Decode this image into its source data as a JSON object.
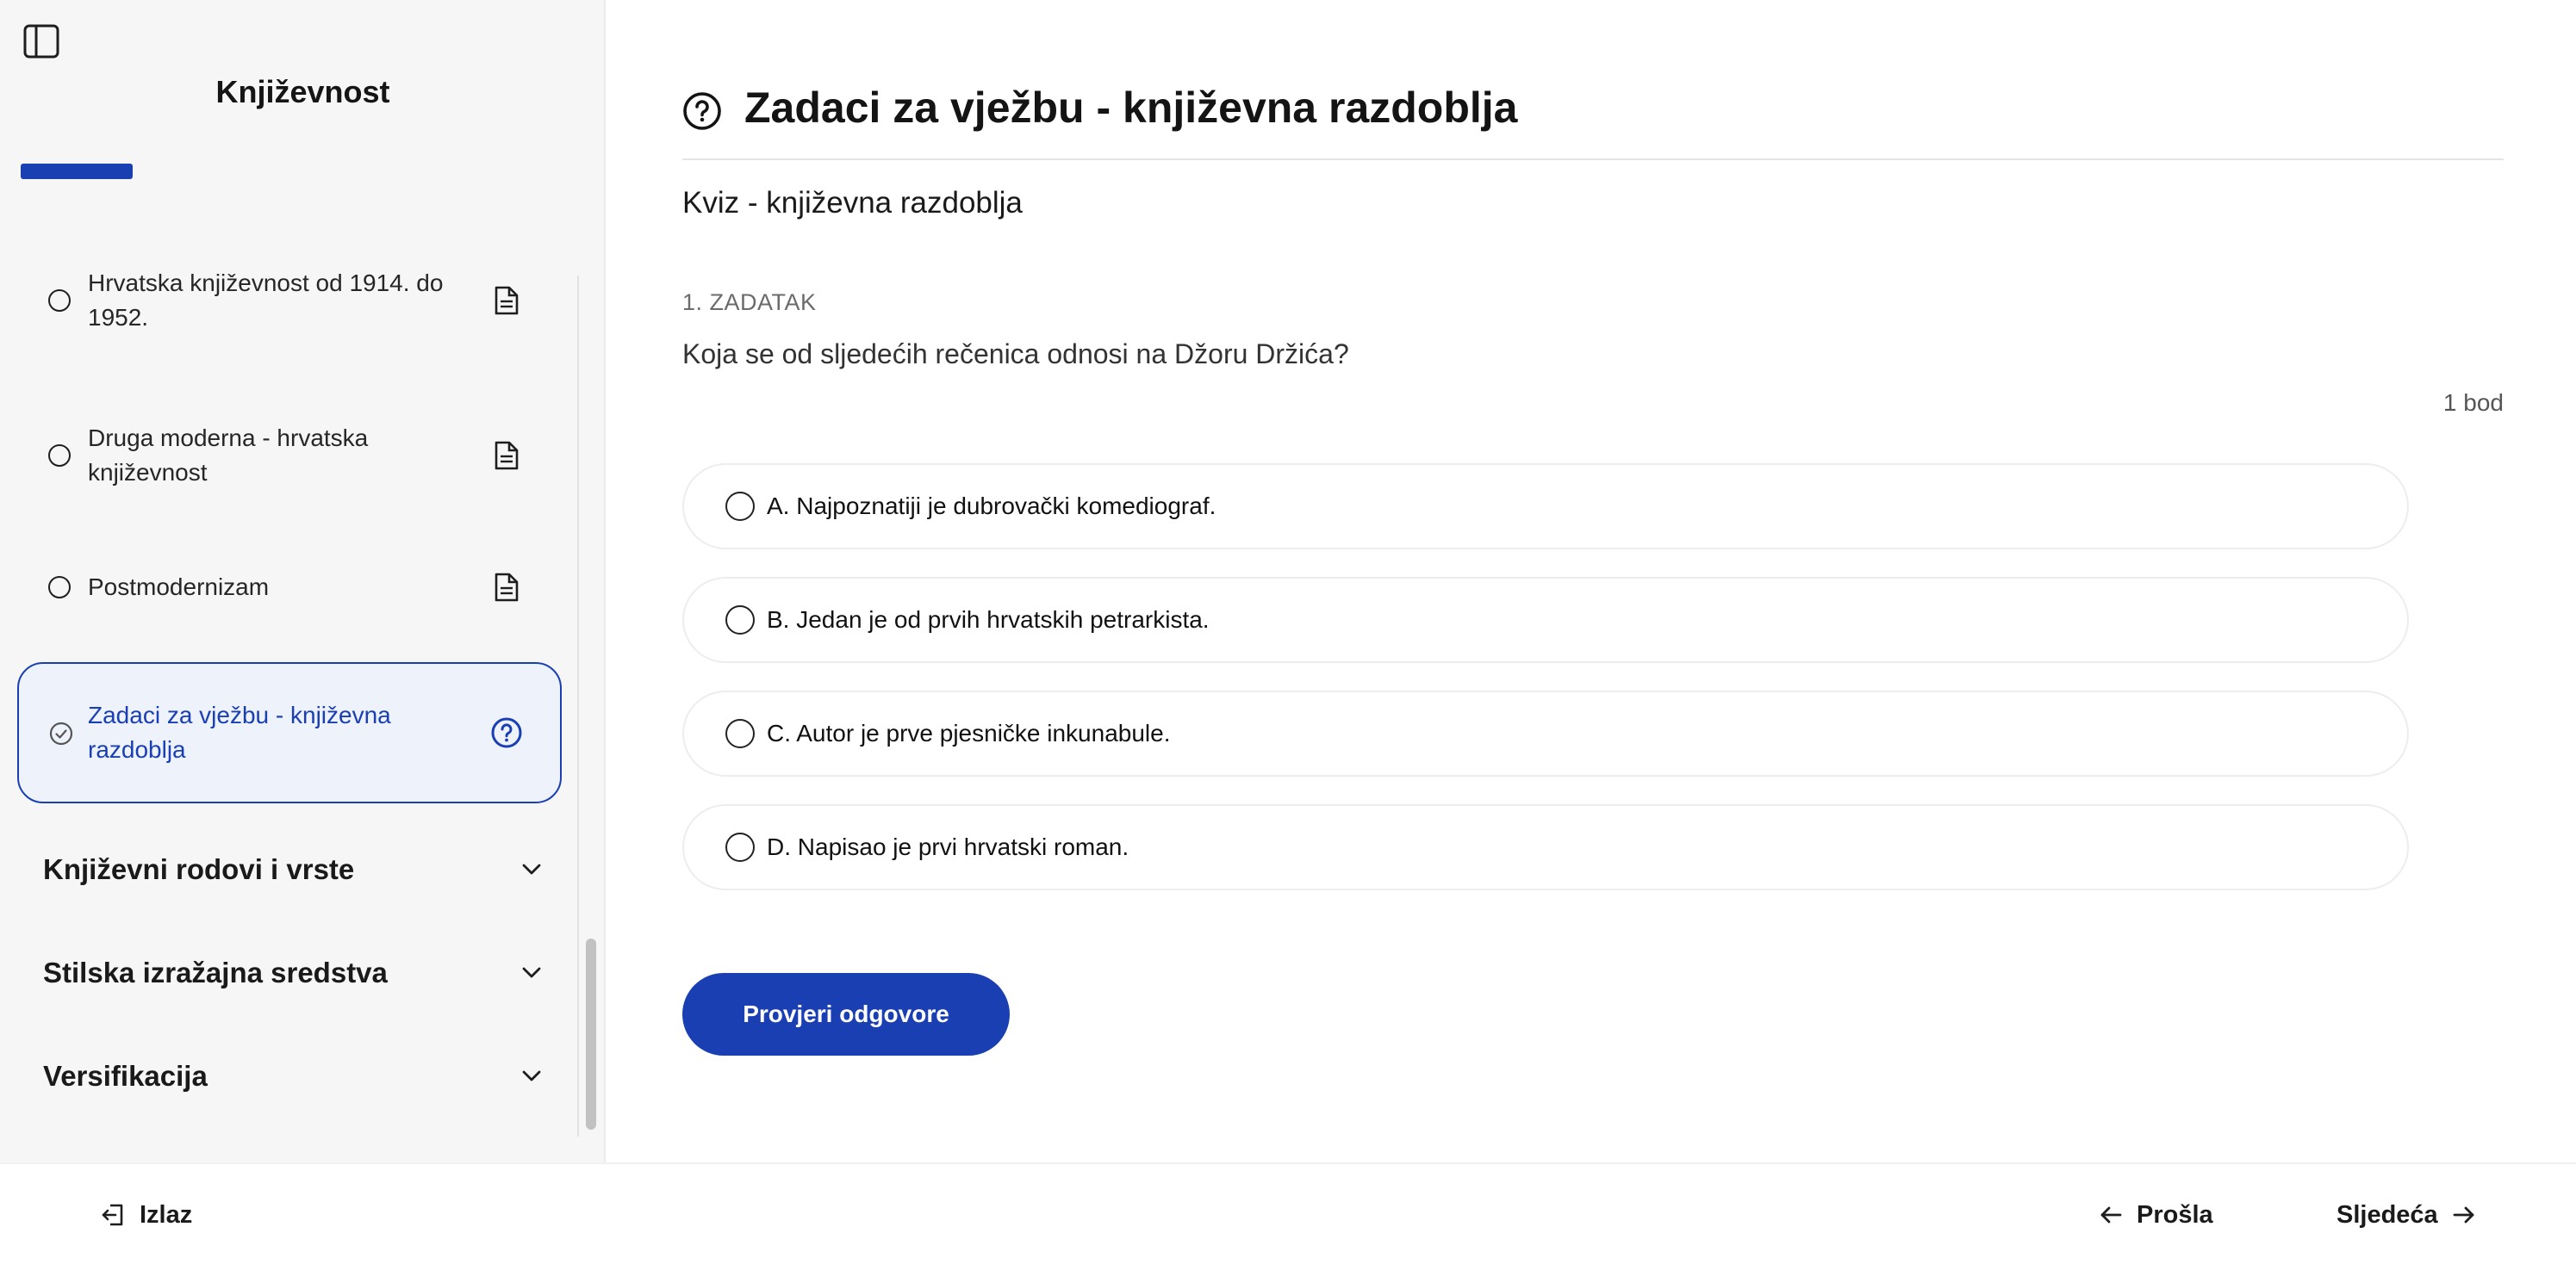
{
  "sidebar": {
    "toggle_icon": "sidebar-panel-icon",
    "course_title": "Književnost",
    "progress_fraction": 0.2,
    "lessons": [
      {
        "label": "Hrvatska književnost od 1914. do 1952.",
        "icon": "document-icon",
        "status": "incomplete"
      },
      {
        "label": "Druga moderna - hrvatska književnost",
        "icon": "document-icon",
        "status": "incomplete"
      },
      {
        "label": "Postmodernizam",
        "icon": "document-icon",
        "status": "incomplete"
      },
      {
        "label": "Zadaci za vježbu - književna razdoblja",
        "icon": "question-circle-icon",
        "status": "active"
      }
    ],
    "sections": [
      {
        "label": "Književni rodovi i vrste",
        "icon": "chevron-down-icon"
      },
      {
        "label": "Stilska izražajna sredstva",
        "icon": "chevron-down-icon"
      },
      {
        "label": "Versifikacija",
        "icon": "chevron-down-icon"
      }
    ]
  },
  "main": {
    "title_icon": "question-circle-icon",
    "title": "Zadaci za vježbu - književna razdoblja",
    "quiz_name": "Kviz - književna razdoblja",
    "task_number": "1. ZADATAK",
    "question": "Koja se od sljedećih rečenica odnosi na Džoru Držića?",
    "points": "1 bod",
    "options": [
      {
        "label": "A. Najpoznatiji je dubrovački komediograf."
      },
      {
        "label": "B. Jedan je od prvih hrvatskih petrarkista."
      },
      {
        "label": "C. Autor je prve pjesničke inkunabule."
      },
      {
        "label": "D. Napisao je prvi hrvatski roman."
      }
    ],
    "check_button": "Provjeri odgovore"
  },
  "footer": {
    "exit_label": "Izlaz",
    "prev_label": "Prošla",
    "next_label": "Sljedeća"
  },
  "colors": {
    "accent": "#1a3fb3",
    "active_bg": "#eef2fb",
    "sidebar_bg": "#f6f6f6"
  }
}
